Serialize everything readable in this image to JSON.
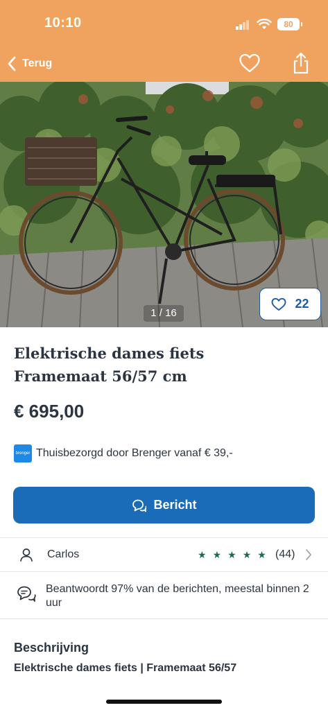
{
  "status_bar": {
    "time": "10:10",
    "battery": "80"
  },
  "nav": {
    "back_label": "Terug"
  },
  "photo": {
    "counter": "1 / 16",
    "likes": "22"
  },
  "listing": {
    "title_line1": "Elektrische dames fiets",
    "title_line2": "Framemaat 56/57 cm",
    "price": "€ 695,00"
  },
  "delivery": {
    "logo_text": "brenger",
    "text": "Thuisbezorgd door Brenger vanaf € 39,-"
  },
  "message_button": {
    "label": "Bericht"
  },
  "seller": {
    "name": "Carlos",
    "rating_stars": 5,
    "reviews": "(44)"
  },
  "response": {
    "text": "Beantwoordt 97% van de berichten, meestal binnen 2 uur"
  },
  "description": {
    "heading": "Beschrijving",
    "text": "Elektrische dames fiets | Framemaat 56/57"
  },
  "colors": {
    "header": "#f0a35e",
    "primary": "#1a6bb8",
    "star": "#1e6b52",
    "text": "#2b3441"
  },
  "icons": [
    "back-chevron-icon",
    "heart-icon",
    "share-icon",
    "chat-bubbles-icon",
    "user-icon",
    "star-icon",
    "chevron-right-icon",
    "response-chat-icon"
  ]
}
